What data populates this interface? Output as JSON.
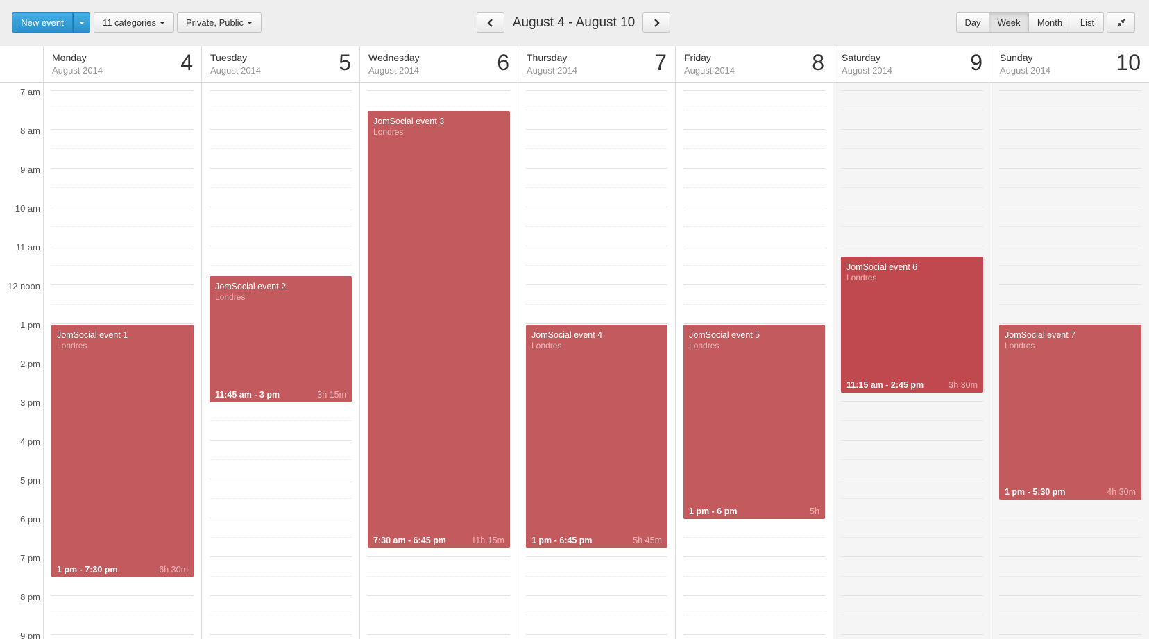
{
  "toolbar": {
    "new_event_label": "New event",
    "categories_label": "11 categories",
    "privacy_label": "Private, Public",
    "range_title": "August 4 - August 10",
    "views": [
      "Day",
      "Week",
      "Month",
      "List"
    ],
    "active_view": "Week"
  },
  "days": [
    {
      "name": "Monday",
      "month": "August 2014",
      "number": "4"
    },
    {
      "name": "Tuesday",
      "month": "August 2014",
      "number": "5"
    },
    {
      "name": "Wednesday",
      "month": "August 2014",
      "number": "6"
    },
    {
      "name": "Thursday",
      "month": "August 2014",
      "number": "7"
    },
    {
      "name": "Friday",
      "month": "August 2014",
      "number": "8"
    },
    {
      "name": "Saturday",
      "month": "August 2014",
      "number": "9"
    },
    {
      "name": "Sunday",
      "month": "August 2014",
      "number": "10"
    }
  ],
  "hours": [
    "7 am",
    "8 am",
    "9 am",
    "10 am",
    "11 am",
    "12 noon",
    "1 pm",
    "2 pm",
    "3 pm",
    "4 pm",
    "5 pm",
    "6 pm",
    "7 pm",
    "8 pm",
    "9 pm"
  ],
  "events": [
    {
      "title": "JomSocial event 1",
      "location": "Londres",
      "time": "1 pm - 7:30 pm",
      "duration": "6h 30m"
    },
    {
      "title": "JomSocial event 2",
      "location": "Londres",
      "time": "11:45 am - 3 pm",
      "duration": "3h 15m"
    },
    {
      "title": "JomSocial event 3",
      "location": "Londres",
      "time": "7:30 am - 6:45 pm",
      "duration": "11h 15m"
    },
    {
      "title": "JomSocial event 4",
      "location": "Londres",
      "time": "1 pm - 6:45 pm",
      "duration": "5h 45m"
    },
    {
      "title": "JomSocial event 5",
      "location": "Londres",
      "time": "1 pm - 6 pm",
      "duration": "5h"
    },
    {
      "title": "JomSocial event 6",
      "location": "Londres",
      "time": "11:15 am - 2:45 pm",
      "duration": "3h 30m"
    },
    {
      "title": "JomSocial event 7",
      "location": "Londres",
      "time": "1 pm - 5:30 pm",
      "duration": "4h 30m"
    }
  ],
  "colors": {
    "primary_button": "#2a93cb",
    "event": "#c25a5e",
    "event_selected": "#bf494e",
    "weekend_bg": "#f5f5f5"
  },
  "icons": {
    "prev": "chevron-left-icon",
    "next": "chevron-right-icon",
    "fullscreen": "compress-icon",
    "dropdown": "caret-down-icon"
  }
}
